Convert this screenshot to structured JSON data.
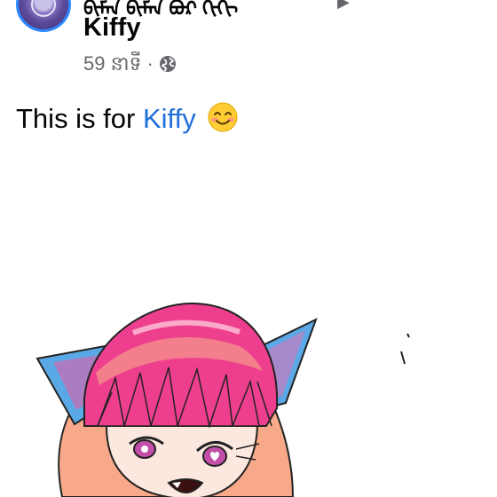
{
  "post": {
    "author_top_line": "ᠪᠢᠮᠠᠨ ᠪᠢᠮᠠᠨ ᠪᠣᠷ ᠬᠢᠬᠢ",
    "group_name": "Kiffy",
    "time": "59 នាទី",
    "separator": "·",
    "privacy_icon": "globe-icon",
    "text_before": "This is for ",
    "mention": "Kiffy",
    "emoji": "smiling-face-icon"
  },
  "colors": {
    "mention": "#216fdb",
    "avatar_ring": "#2d88ff",
    "meta_text": "#65676b"
  }
}
